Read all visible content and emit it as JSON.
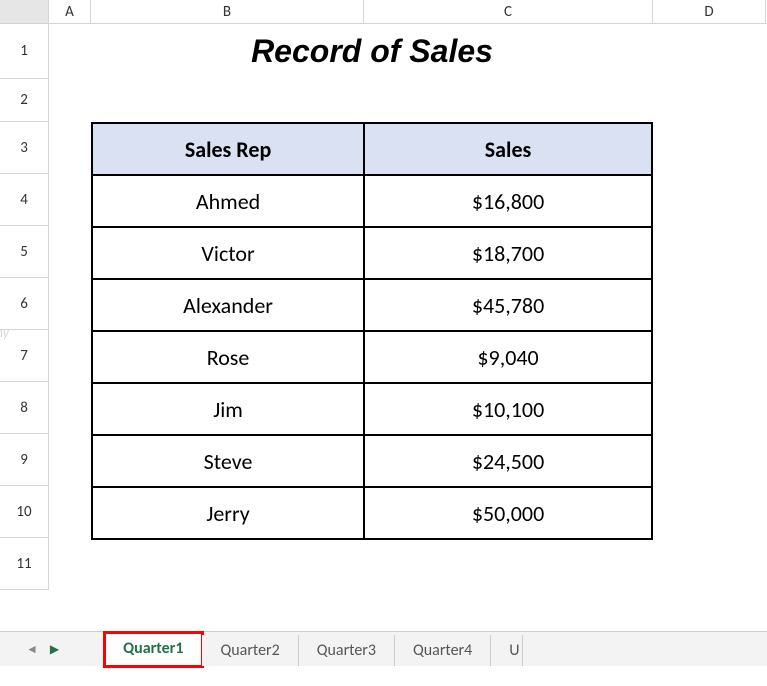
{
  "title": "Record of Sales",
  "columns": {
    "A": "A",
    "B": "B",
    "C": "C",
    "D": "D"
  },
  "rows": [
    "1",
    "2",
    "3",
    "4",
    "5",
    "6",
    "7",
    "8",
    "9",
    "10",
    "11"
  ],
  "table": {
    "headers": {
      "rep": "Sales Rep",
      "sales": "Sales"
    },
    "rows": [
      {
        "rep": "Ahmed",
        "sales": "$16,800"
      },
      {
        "rep": "Victor",
        "sales": "$18,700"
      },
      {
        "rep": "Alexander",
        "sales": "$45,780"
      },
      {
        "rep": "Rose",
        "sales": "$9,040"
      },
      {
        "rep": "Jim",
        "sales": "$10,100"
      },
      {
        "rep": "Steve",
        "sales": "$24,500"
      },
      {
        "rep": "Jerry",
        "sales": "$50,000"
      }
    ]
  },
  "tabs": [
    {
      "label": "Quarter1",
      "active": true,
      "highlighted": true
    },
    {
      "label": "Quarter2",
      "active": false
    },
    {
      "label": "Quarter3",
      "active": false
    },
    {
      "label": "Quarter4",
      "active": false
    },
    {
      "label": "U",
      "active": false,
      "cut": true
    }
  ],
  "watermark": "ExcelDemy"
}
